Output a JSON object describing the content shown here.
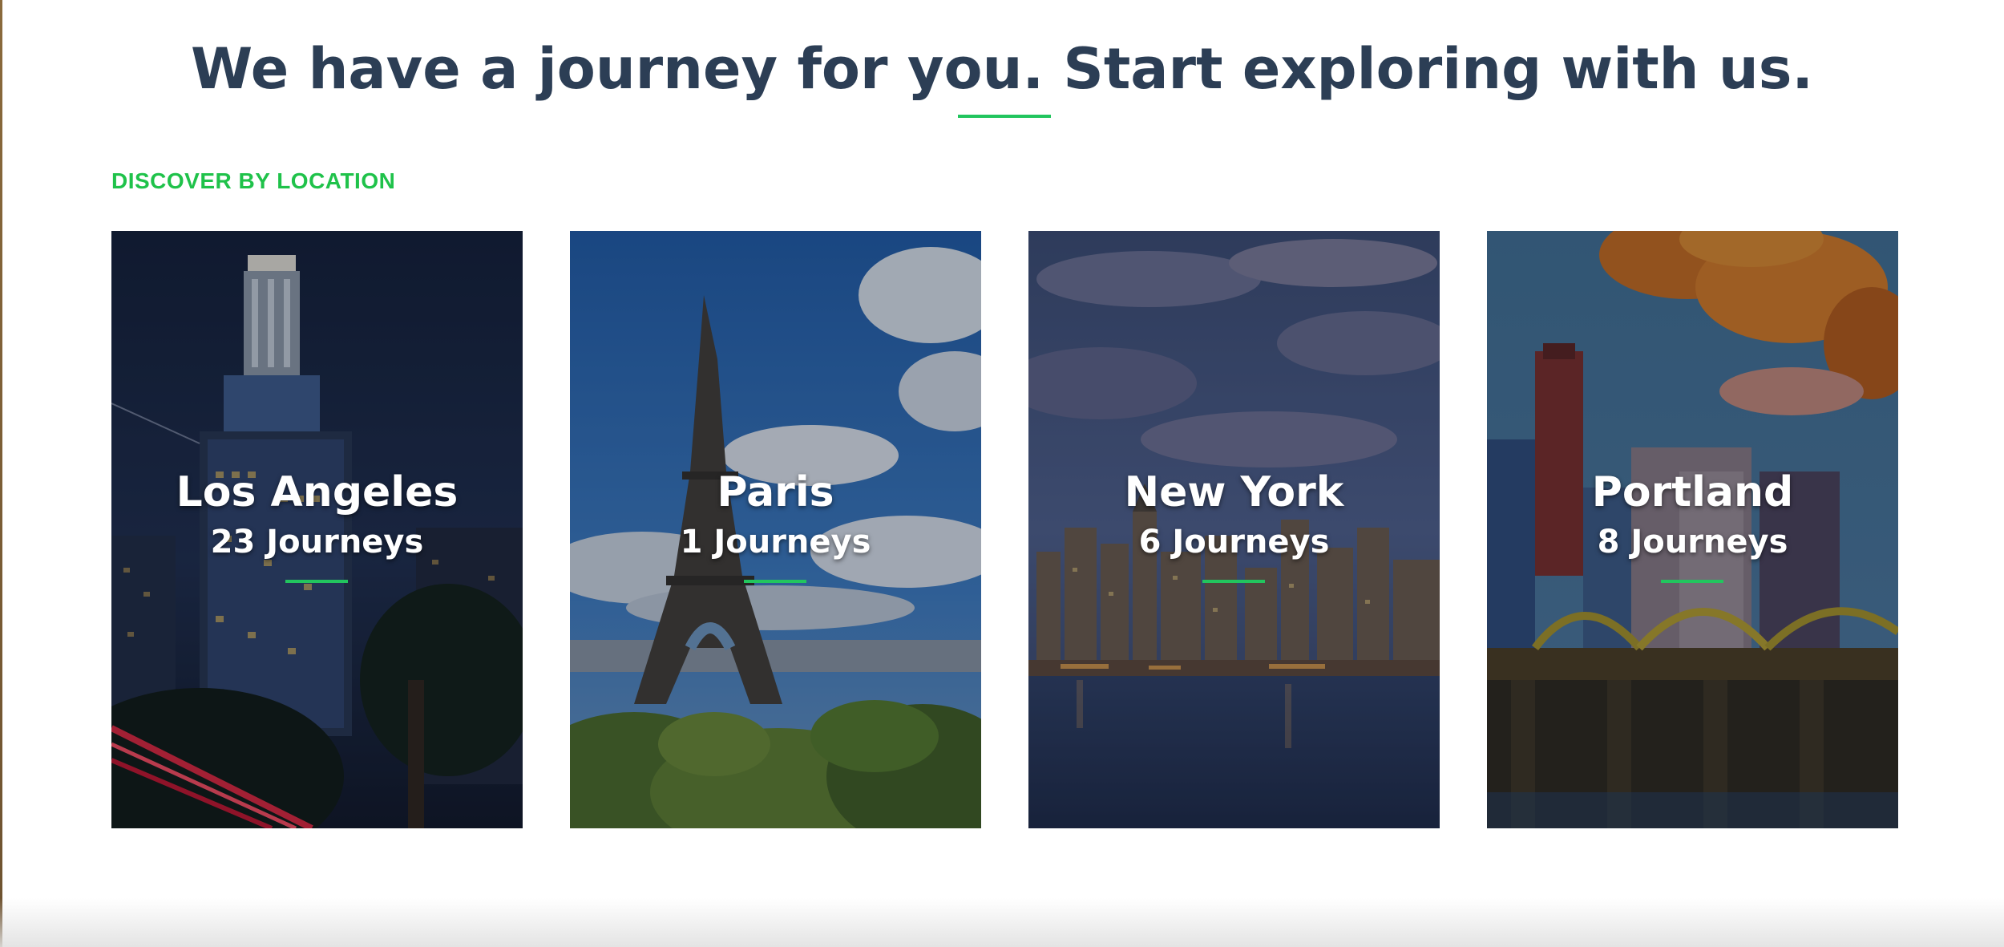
{
  "header": {
    "title": "We have a journey for you. Start exploring with us."
  },
  "section": {
    "label": "DISCOVER BY LOCATION"
  },
  "locations": [
    {
      "city": "Los Angeles",
      "journeys": "23 Journeys"
    },
    {
      "city": "Paris",
      "journeys": "1 Journeys"
    },
    {
      "city": "New York",
      "journeys": "6 Journeys"
    },
    {
      "city": "Portland",
      "journeys": "8 Journeys"
    }
  ],
  "colors": {
    "title": "#2c3e55",
    "accent": "#22c55e",
    "label": "#1fc24a"
  }
}
